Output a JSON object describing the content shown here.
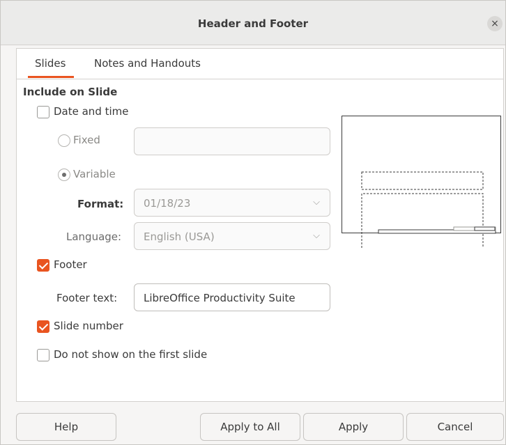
{
  "window": {
    "title": "Header and Footer",
    "close_glyph": "×"
  },
  "tabs": [
    {
      "label": "Slides",
      "active": true
    },
    {
      "label": "Notes and Handouts",
      "active": false
    }
  ],
  "section_heading": "Include on Slide",
  "date_time": {
    "label": "Date and time",
    "checked": false,
    "fixed_label": "Fixed",
    "fixed_value": "",
    "variable_label": "Variable",
    "selected": "Variable",
    "format_label": "Format:",
    "format_value": "01/18/23",
    "language_label": "Language:",
    "language_value": "English (USA)"
  },
  "footer": {
    "label": "Footer",
    "checked": true,
    "text_label": "Footer text:",
    "text_value": "LibreOffice Productivity Suite"
  },
  "slide_number": {
    "label": "Slide number",
    "checked": true
  },
  "first_slide": {
    "label": "Do not show on the first slide",
    "checked": false
  },
  "buttons": {
    "help": "Help",
    "apply_all": "Apply to All",
    "apply": "Apply",
    "cancel": "Cancel"
  },
  "colors": {
    "accent": "#e95420",
    "panel": "#ffffff",
    "background": "#f6f5f4"
  },
  "icons": {
    "close": "close-icon",
    "chevron": "chevron-down-icon"
  }
}
